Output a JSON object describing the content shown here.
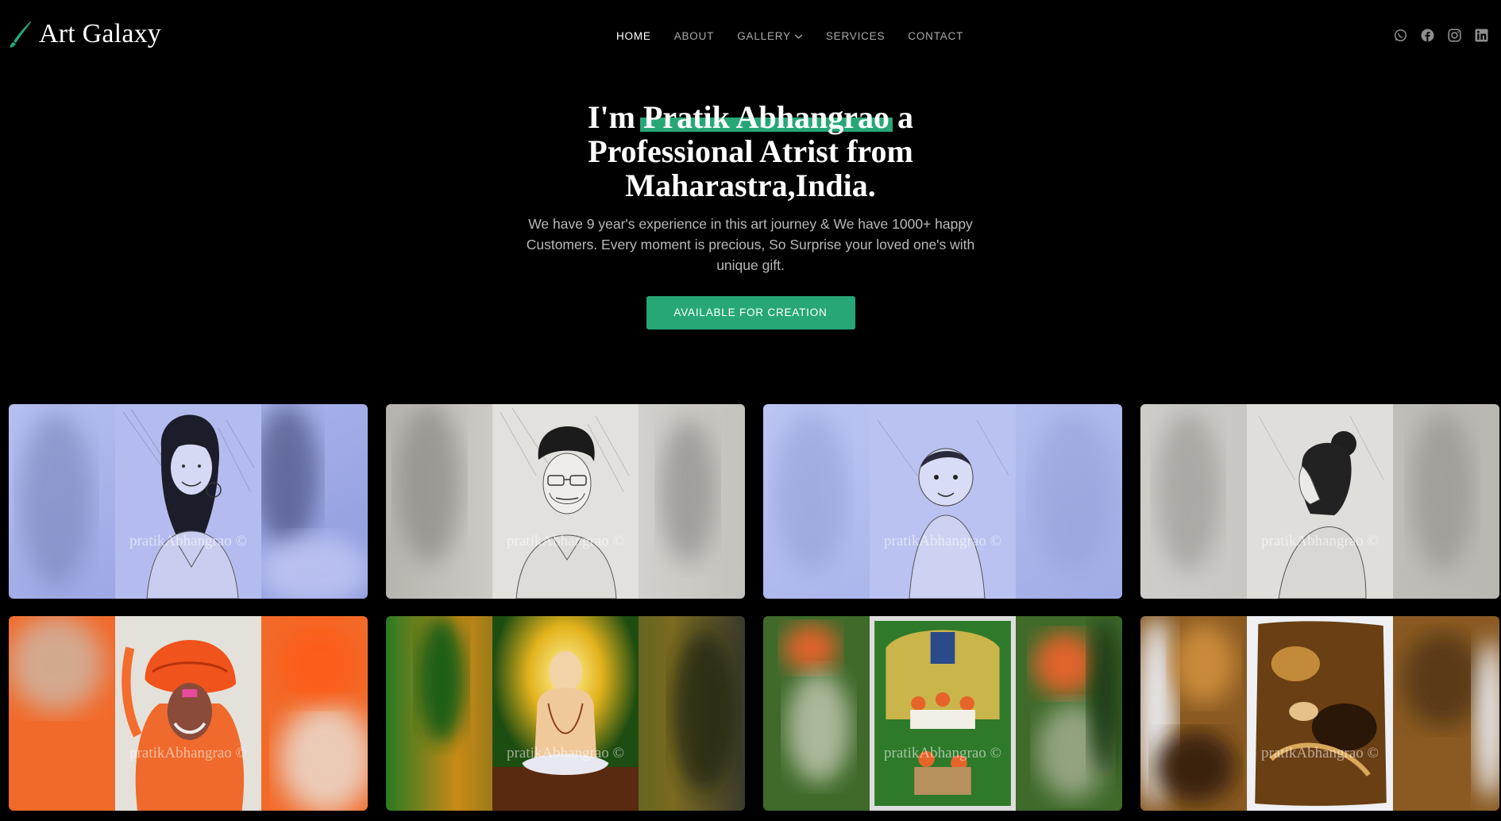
{
  "brand": {
    "name": "Art Galaxy",
    "icon": "brush-icon",
    "accent": "#27a776"
  },
  "nav": {
    "home": "HOME",
    "about": "ABOUT",
    "gallery": "GALLERY",
    "services": "SERVICES",
    "contact": "CONTACT"
  },
  "social": [
    "whatsapp-icon",
    "facebook-icon",
    "instagram-icon",
    "linkedin-icon"
  ],
  "hero": {
    "prefix": "I'm ",
    "name": "Pratik Abhangrao",
    "suffix": " a Professional Atrist from Maharastra,India.",
    "subtitle": "We have 9 year's experience in this art journey & We have 1000+ happy Customers. Every moment is precious, So Surprise your loved one's with unique gift.",
    "cta": "AVAILABLE FOR CREATION"
  },
  "gallery": {
    "watermark": "pratikAbhangrao ©",
    "items": [
      {
        "subject": "pencil portrait of smiling woman"
      },
      {
        "subject": "pencil portrait of man with glasses"
      },
      {
        "subject": "pencil portrait of baby"
      },
      {
        "subject": "pencil portrait of woman in profile"
      },
      {
        "subject": "color portrait of man in orange turban"
      },
      {
        "subject": "painting of seated saint"
      },
      {
        "subject": "painting of village scene"
      },
      {
        "subject": "brown abstract artwork"
      }
    ]
  }
}
